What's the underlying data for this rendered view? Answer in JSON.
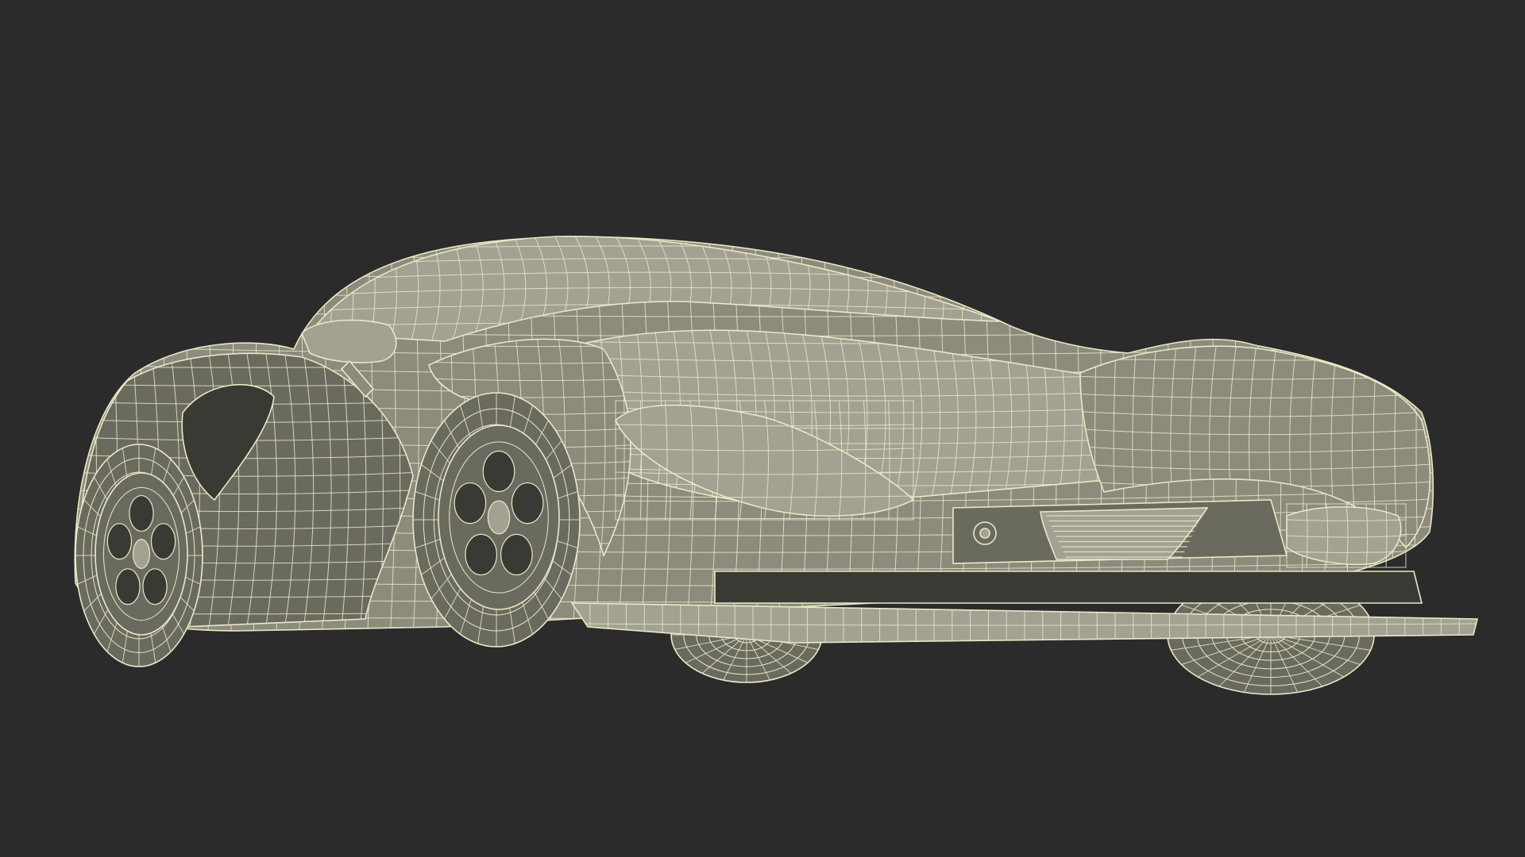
{
  "colors": {
    "background": "#2b2b2b",
    "surface": "#8c8b7c",
    "surface_dark": "#6b6a5e",
    "surface_light": "#a2a192",
    "wire": "#e9e8c8",
    "cavity": "#3a3a34"
  }
}
